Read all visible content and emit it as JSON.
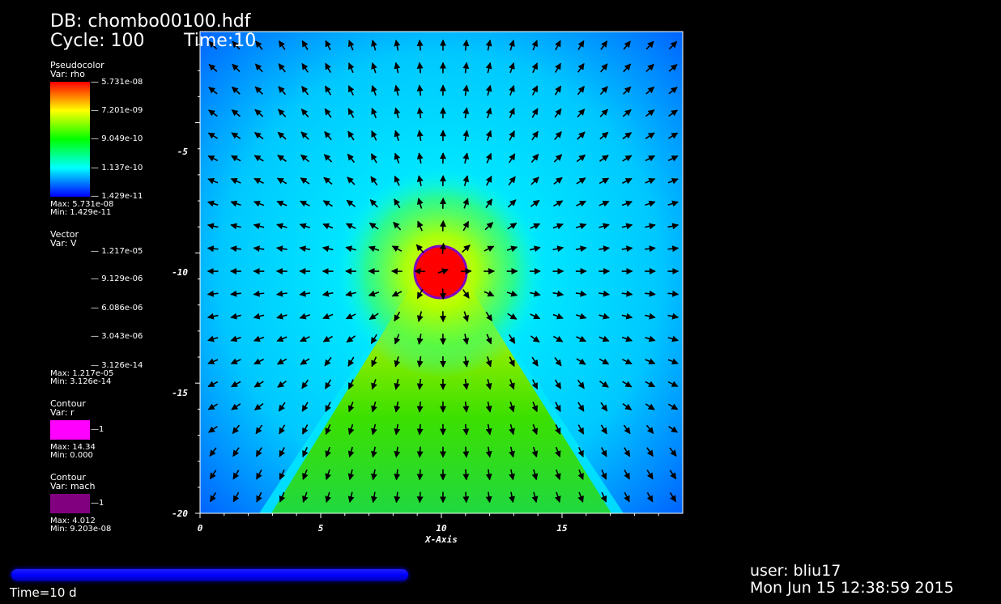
{
  "header": {
    "db": "DB: chombo00100.hdf",
    "cycle": "Cycle: 100",
    "time": "Time:10"
  },
  "pseudocolor": {
    "title": "Pseudocolor",
    "var": "Var: rho",
    "ticks": [
      "5.731e-08",
      "7.201e-09",
      "9.049e-10",
      "1.137e-10",
      "1.429e-11"
    ],
    "max": "Max:  5.731e-08",
    "min": "Min:  1.429e-11"
  },
  "vector": {
    "title": "Vector",
    "var": "Var: V",
    "ticks": [
      "1.217e-05",
      "9.129e-06",
      "6.086e-06",
      "3.043e-06",
      "3.126e-14"
    ],
    "max": "Max:  1.217e-05",
    "min": "Min:  3.126e-14"
  },
  "contour_r": {
    "title": "Contour",
    "var": "Var: r",
    "level": "1",
    "color": "#ff00ff",
    "max": "Max:  14.34",
    "min": "Min:  0.000"
  },
  "contour_mach": {
    "title": "Contour",
    "var": "Var: mach",
    "level": "1",
    "color": "#800080",
    "max": "Max:  4.012",
    "min": "Min:  9.203e-08"
  },
  "plot": {
    "x_axis_title": "X-Axis",
    "x_ticks": [
      "0",
      "5",
      "10",
      "15"
    ],
    "y_ticks": [
      "-5",
      "-10",
      "-15",
      "-20"
    ],
    "xlim": [
      0,
      20
    ],
    "ylim": [
      -20,
      -1.5
    ],
    "obstacle_center": [
      10,
      -10
    ]
  },
  "footer": {
    "time": "Time=10 d",
    "user": "user: bliu17",
    "date": "Mon Jun 15 12:38:59 2015"
  }
}
